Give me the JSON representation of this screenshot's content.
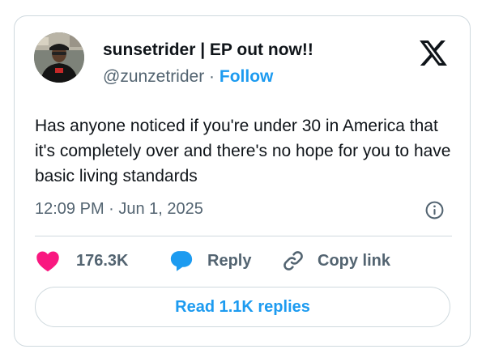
{
  "author": {
    "display_name": "sunsetrider | EP out now!!",
    "handle": "@zunzetrider",
    "separator": "·",
    "follow_label": "Follow"
  },
  "tweet": {
    "text": "Has anyone noticed if you're under 30 in America that it's completely over and there's no hope for you to have basic living standards",
    "timestamp": "12:09 PM · Jun 1, 2025"
  },
  "actions": {
    "like_count": "176.3K",
    "reply_label": "Reply",
    "copy_link_label": "Copy link"
  },
  "footer": {
    "read_replies_label": "Read 1.1K replies"
  },
  "icons": {
    "brand": "x-logo-icon",
    "info": "info-icon",
    "like": "heart-icon",
    "reply": "speech-bubble-icon",
    "copy": "link-icon"
  },
  "colors": {
    "accent": "#1d9bf0",
    "like": "#f91880",
    "text": "#0f1419",
    "secondary": "#536471",
    "border": "#cfd9de"
  }
}
